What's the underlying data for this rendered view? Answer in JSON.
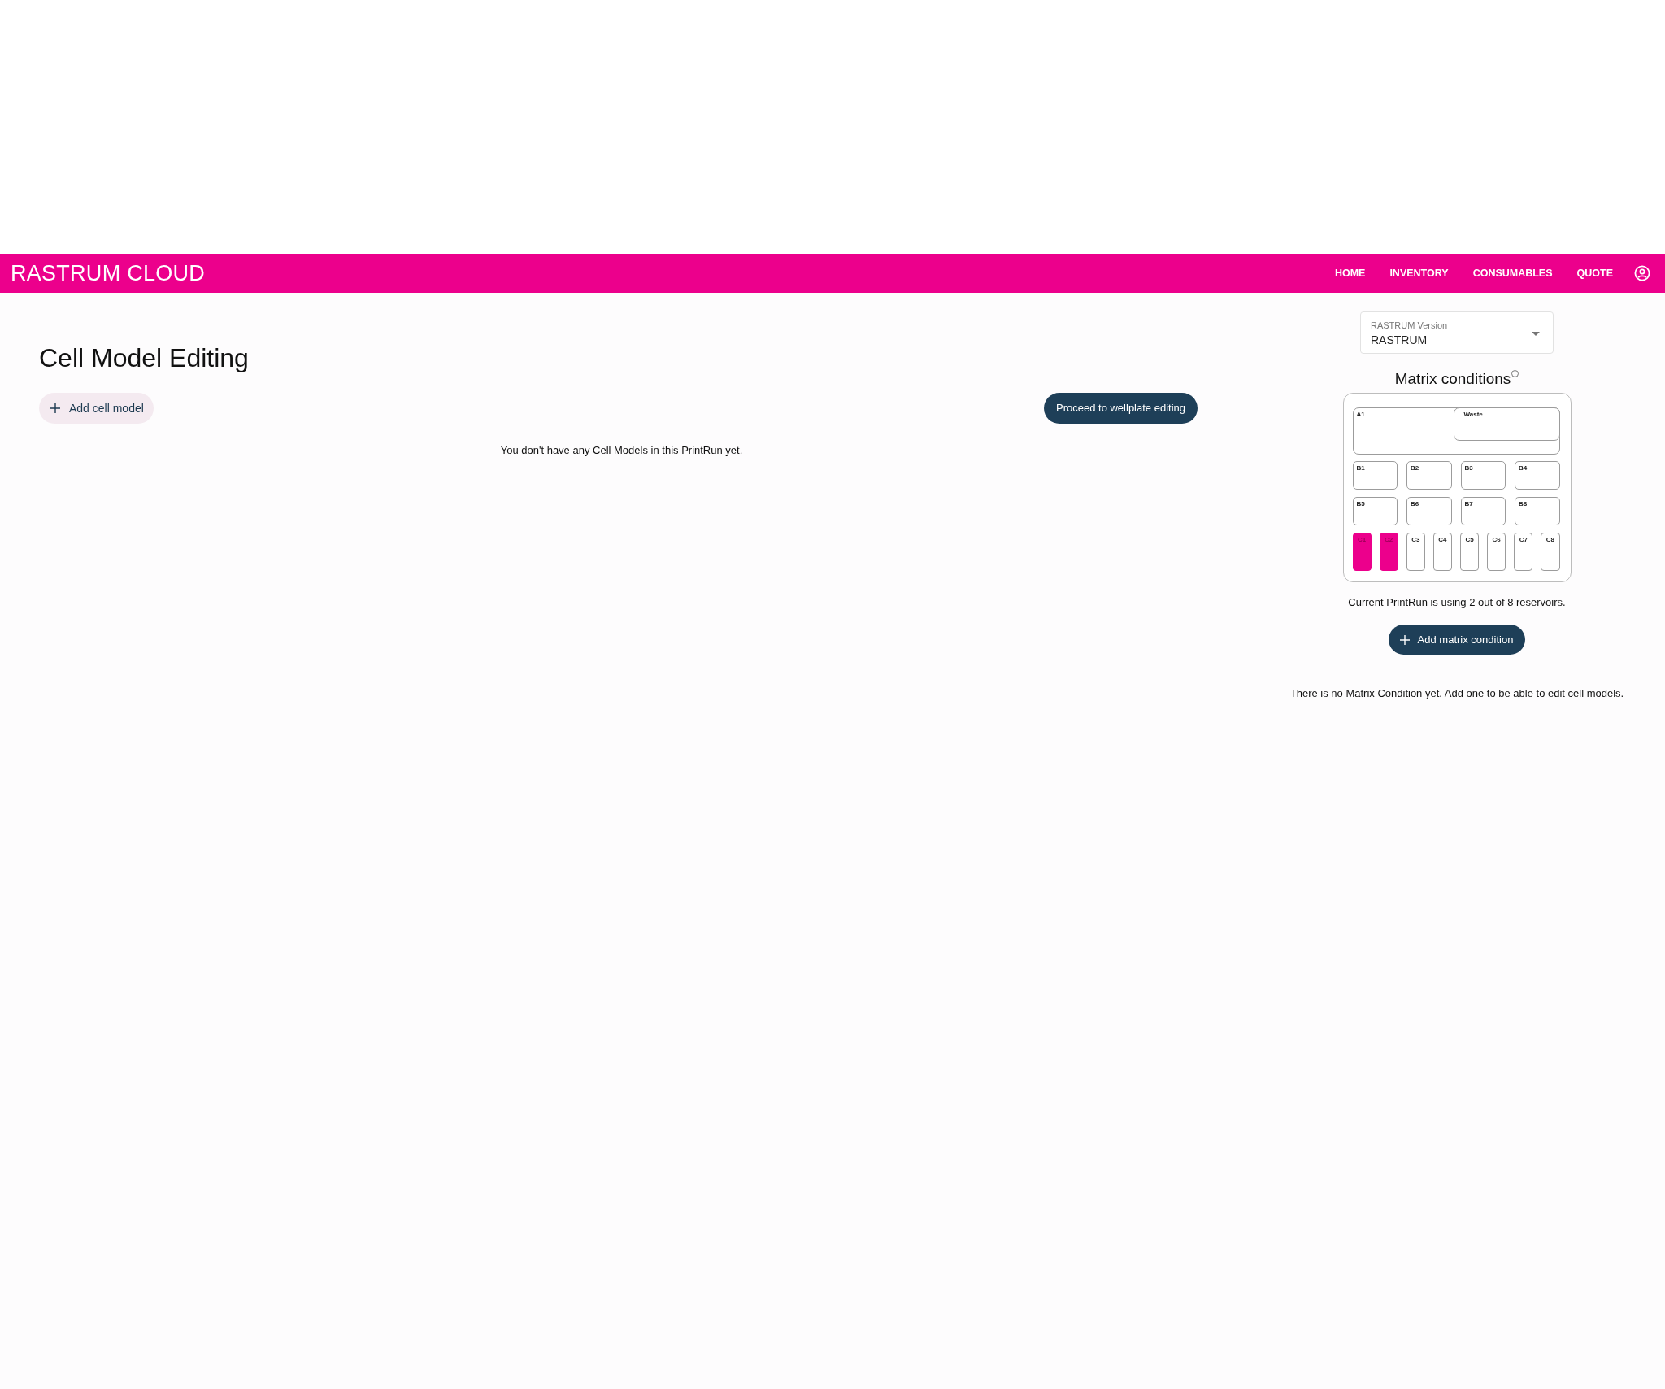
{
  "header": {
    "logo": "RASTRUM CLOUD",
    "nav": [
      {
        "label": "HOME"
      },
      {
        "label": "INVENTORY"
      },
      {
        "label": "CONSUMABLES"
      },
      {
        "label": "QUOTE"
      }
    ]
  },
  "cell_models": {
    "title": "Cell Model Editing",
    "add_button": "Add cell model",
    "proceed_button": "Proceed to wellplate editing",
    "empty_message": "You don't have any Cell Models in this PrintRun yet."
  },
  "matrix": {
    "version_select": {
      "label": "RASTRUM Version",
      "value": "RASTRUM"
    },
    "title": "Matrix conditions",
    "plate": {
      "rows": [
        {
          "kind": "reservoir",
          "wells": [
            {
              "label": "A1",
              "kind": "main",
              "in_use": false
            },
            {
              "label": "Waste",
              "kind": "waste",
              "in_use": false
            }
          ]
        },
        {
          "kind": "wide",
          "wells": [
            {
              "label": "B1",
              "kind": "well",
              "in_use": false
            },
            {
              "label": "B2",
              "kind": "well",
              "in_use": false
            },
            {
              "label": "B3",
              "kind": "well",
              "in_use": false
            },
            {
              "label": "B4",
              "kind": "well",
              "in_use": false
            }
          ]
        },
        {
          "kind": "wide",
          "wells": [
            {
              "label": "B5",
              "kind": "well",
              "in_use": false
            },
            {
              "label": "B6",
              "kind": "well",
              "in_use": false
            },
            {
              "label": "B7",
              "kind": "well",
              "in_use": false
            },
            {
              "label": "B8",
              "kind": "well",
              "in_use": false
            }
          ]
        },
        {
          "kind": "narrow",
          "wells": [
            {
              "label": "C1",
              "kind": "well",
              "in_use": true
            },
            {
              "label": "C2",
              "kind": "well",
              "in_use": true
            },
            {
              "label": "C3",
              "kind": "well",
              "in_use": false
            },
            {
              "label": "C4",
              "kind": "well",
              "in_use": false
            },
            {
              "label": "C5",
              "kind": "well",
              "in_use": false
            },
            {
              "label": "C6",
              "kind": "well",
              "in_use": false
            },
            {
              "label": "C7",
              "kind": "well",
              "in_use": false
            },
            {
              "label": "C8",
              "kind": "well",
              "in_use": false
            }
          ]
        }
      ]
    },
    "usage": "Current PrintRun is using 2 out of 8 reservoirs.",
    "add_button": "Add matrix condition",
    "empty_message": "There is no Matrix Condition yet. Add one to be able to edit cell models."
  }
}
